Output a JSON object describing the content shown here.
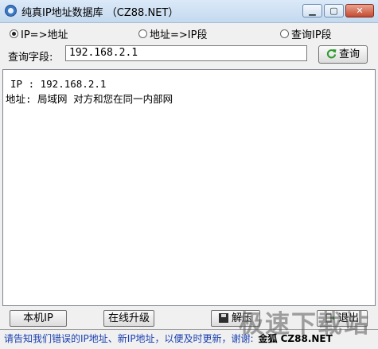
{
  "window": {
    "title": "纯真IP地址数据库 （CZ88.NET）",
    "controls": {
      "minimize": "▁",
      "maximize": "▢",
      "close": "✕"
    }
  },
  "modes": [
    {
      "label": "IP=>地址",
      "checked": true
    },
    {
      "label": "地址=>IP段",
      "checked": false
    },
    {
      "label": "查询IP段",
      "checked": false
    }
  ],
  "query": {
    "label": "查询字段:",
    "value": "192.168.2.1",
    "button_label": "查询",
    "button_icon": "refresh-icon"
  },
  "result": {
    "line1": "IP : 192.168.2.1",
    "line2": "地址: 局域网 对方和您在同一内部网"
  },
  "buttons": {
    "local_ip": "本机IP",
    "online_upgrade": "在线升级",
    "extract": "解压",
    "exit": "退出"
  },
  "status": {
    "text": "请告知我们错误的IP地址、新IP地址，以便及时更新，谢谢:",
    "brand": "金狐 CZ88.NET"
  },
  "watermark": "极速下载站"
}
